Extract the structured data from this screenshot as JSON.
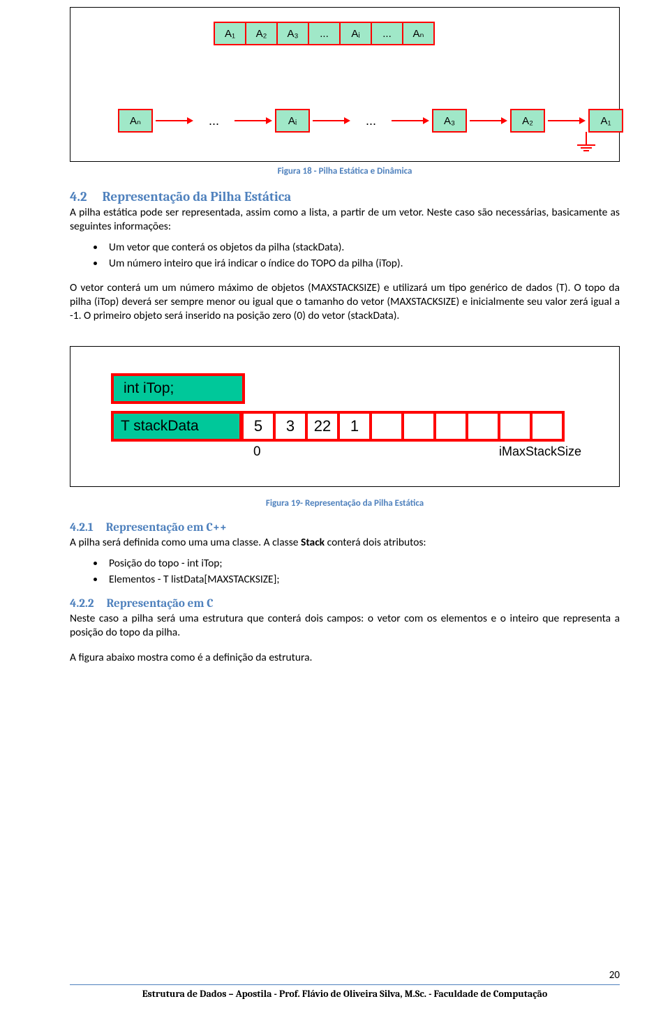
{
  "fig1": {
    "array": [
      "A₁",
      "A₂",
      "A₃",
      "...",
      "Aᵢ",
      "...",
      "Aₙ"
    ],
    "linked": [
      "Aₙ",
      "...",
      "Aᵢ",
      "...",
      "A₃",
      "A₂",
      "A₁"
    ],
    "caption": "Figura 18 - Pilha Estática e Dinâmica"
  },
  "sec42": {
    "num": "4.2",
    "title": "Representação da Pilha Estática",
    "p1": "A pilha estática pode ser representada, assim como a lista, a partir de um vetor. Neste caso são necessárias, basicamente as seguintes informações:",
    "bullets": [
      "Um vetor que conterá os objetos da pilha (stackData).",
      "Um número inteiro que irá indicar o índice do TOPO da pilha (iTop)."
    ],
    "p2": "O vetor conterá um um número máximo de objetos (MAXSTACKSIZE) e utilizará um tipo genérico de dados (T). O topo da pilha (iTop) deverá ser sempre menor ou igual que o tamanho do vetor (MAXSTACKSIZE) e inicialmente seu valor zerá igual a -1. O primeiro objeto será inserido na posição zero (0) do vetor (stackData)."
  },
  "fig2": {
    "itop": "int iTop;",
    "sdlabel": "T stackData",
    "cells": [
      "5",
      "3",
      "22",
      "1",
      "",
      "",
      "",
      "",
      "",
      ""
    ],
    "zero": "0",
    "max": "iMaxStackSize",
    "caption": "Figura 19- Representação da Pilha Estática"
  },
  "sec421": {
    "num": "4.2.1",
    "title": "Representação em C++",
    "p_a": "A pilha será definida como uma uma classe. A classe ",
    "p_bold": "Stack",
    "p_b": " conterá dois atributos:",
    "bullets": [
      "Posição do topo - int iTop;",
      "Elementos - T listData[MAXSTACKSIZE];"
    ]
  },
  "sec422": {
    "num": "4.2.2",
    "title": "Representação em C",
    "p1": "Neste caso a pilha será uma estrutura que conterá dois campos: o vetor com os elementos e o inteiro que representa a posição do topo da pilha.",
    "p2": "A figura abaixo mostra como é a definição da estrutura."
  },
  "footer": "Estrutura de Dados – Apostila - Prof. Flávio de Oliveira Silva, M.Sc. - Faculdade de Computação",
  "pagenum": "20"
}
